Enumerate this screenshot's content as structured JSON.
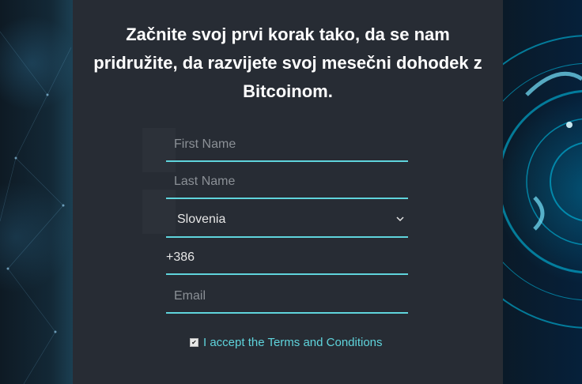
{
  "headline": "Začnite svoj prvi korak tako, da se nam pridružite, da razvijete svoj mesečni dohodek z Bitcoinom.",
  "form": {
    "first_name_placeholder": "First Name",
    "last_name_placeholder": "Last Name",
    "country_selected": "Slovenia",
    "phone_prefix": "+386",
    "email_placeholder": "Email",
    "terms_label": "I accept the Terms and Conditions",
    "terms_checked": true
  },
  "colors": {
    "panel": "#272c34",
    "accent": "#5fd4dc",
    "text": "#ffffff"
  }
}
